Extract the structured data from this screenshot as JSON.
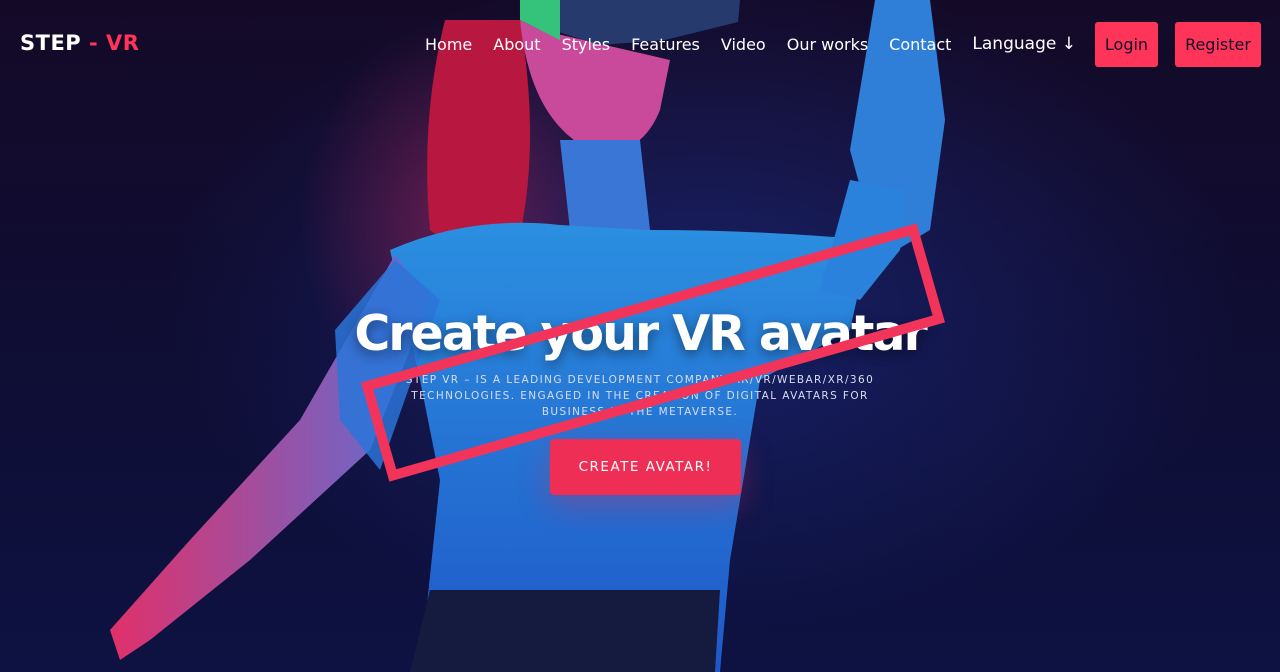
{
  "brand": {
    "step": "STEP",
    "sep": "-",
    "vr": "VR"
  },
  "nav": {
    "items": [
      "Home",
      "About",
      "Styles",
      "Features",
      "Video",
      "Our works",
      "Contact"
    ],
    "language": "Language ↓"
  },
  "auth": {
    "login": "Login",
    "register": "Register"
  },
  "hero": {
    "headline": "Create your VR avatar",
    "subtitle": "STEP VR – IS A LEADING DEVELOPMENT COMPANY AR/VR/WEBAR/XR/360 TECHNOLOGIES. ENGAGED IN THE CREATION OF DIGITAL AVATARS FOR BUSINESS IN THE METAVERSE.",
    "cta": "CREATE AVATAR!"
  },
  "colors": {
    "accent": "#ff3459",
    "background": "#0c0a2c",
    "stamp": "#f2345a"
  }
}
